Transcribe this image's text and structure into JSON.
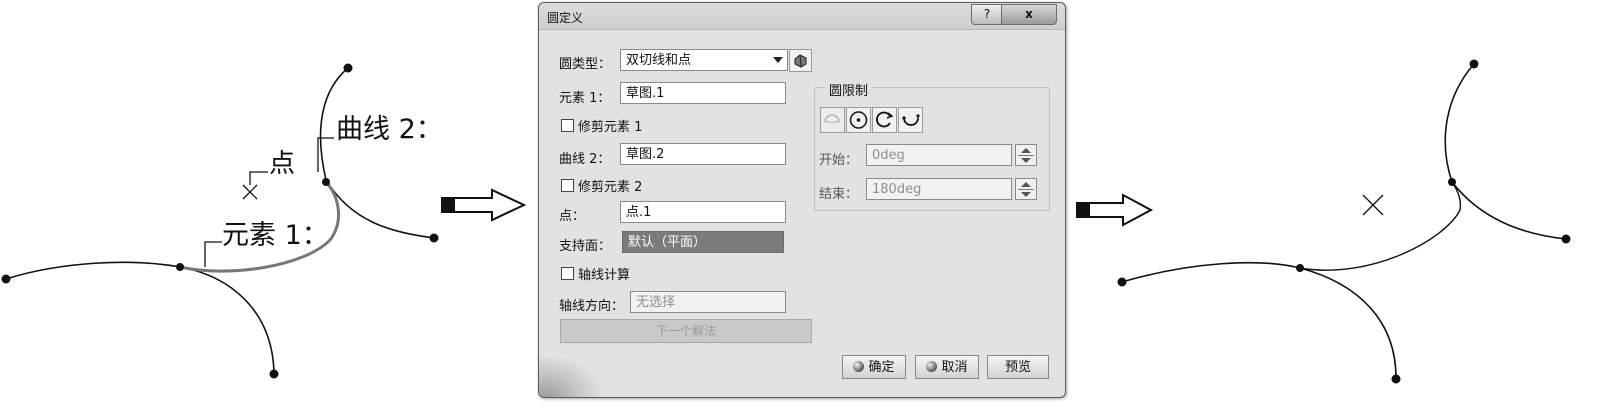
{
  "sketch_left": {
    "label_point": "点",
    "label_curve2": "曲线 2：",
    "label_element1": "元素 1："
  },
  "dialog": {
    "title": "圆定义",
    "help_label": "?",
    "close_label": "x",
    "circle_type_label": "圆类型：",
    "circle_type_value": "双切线和点",
    "element1_label": "元素 1：",
    "element1_value": "草图.1",
    "trim_element1_label": "修剪元素 1",
    "curve2_label": "曲线 2：",
    "curve2_value": "草图.2",
    "trim_element2_label": "修剪元素 2",
    "point_label": "点：",
    "point_value": "点.1",
    "support_label": "支持面：",
    "support_value": "默认（平面）",
    "axis_compute_label": "轴线计算",
    "axis_direction_label": "轴线方向：",
    "axis_direction_placeholder": "无选择",
    "next_solution_label": "下一个解法",
    "circle_limit_title": "圆限制",
    "start_label": "开始：",
    "start_value": "0deg",
    "end_label": "结束：",
    "end_value": "180deg",
    "ok_label": "确定",
    "cancel_label": "取消",
    "preview_label": "预览"
  }
}
